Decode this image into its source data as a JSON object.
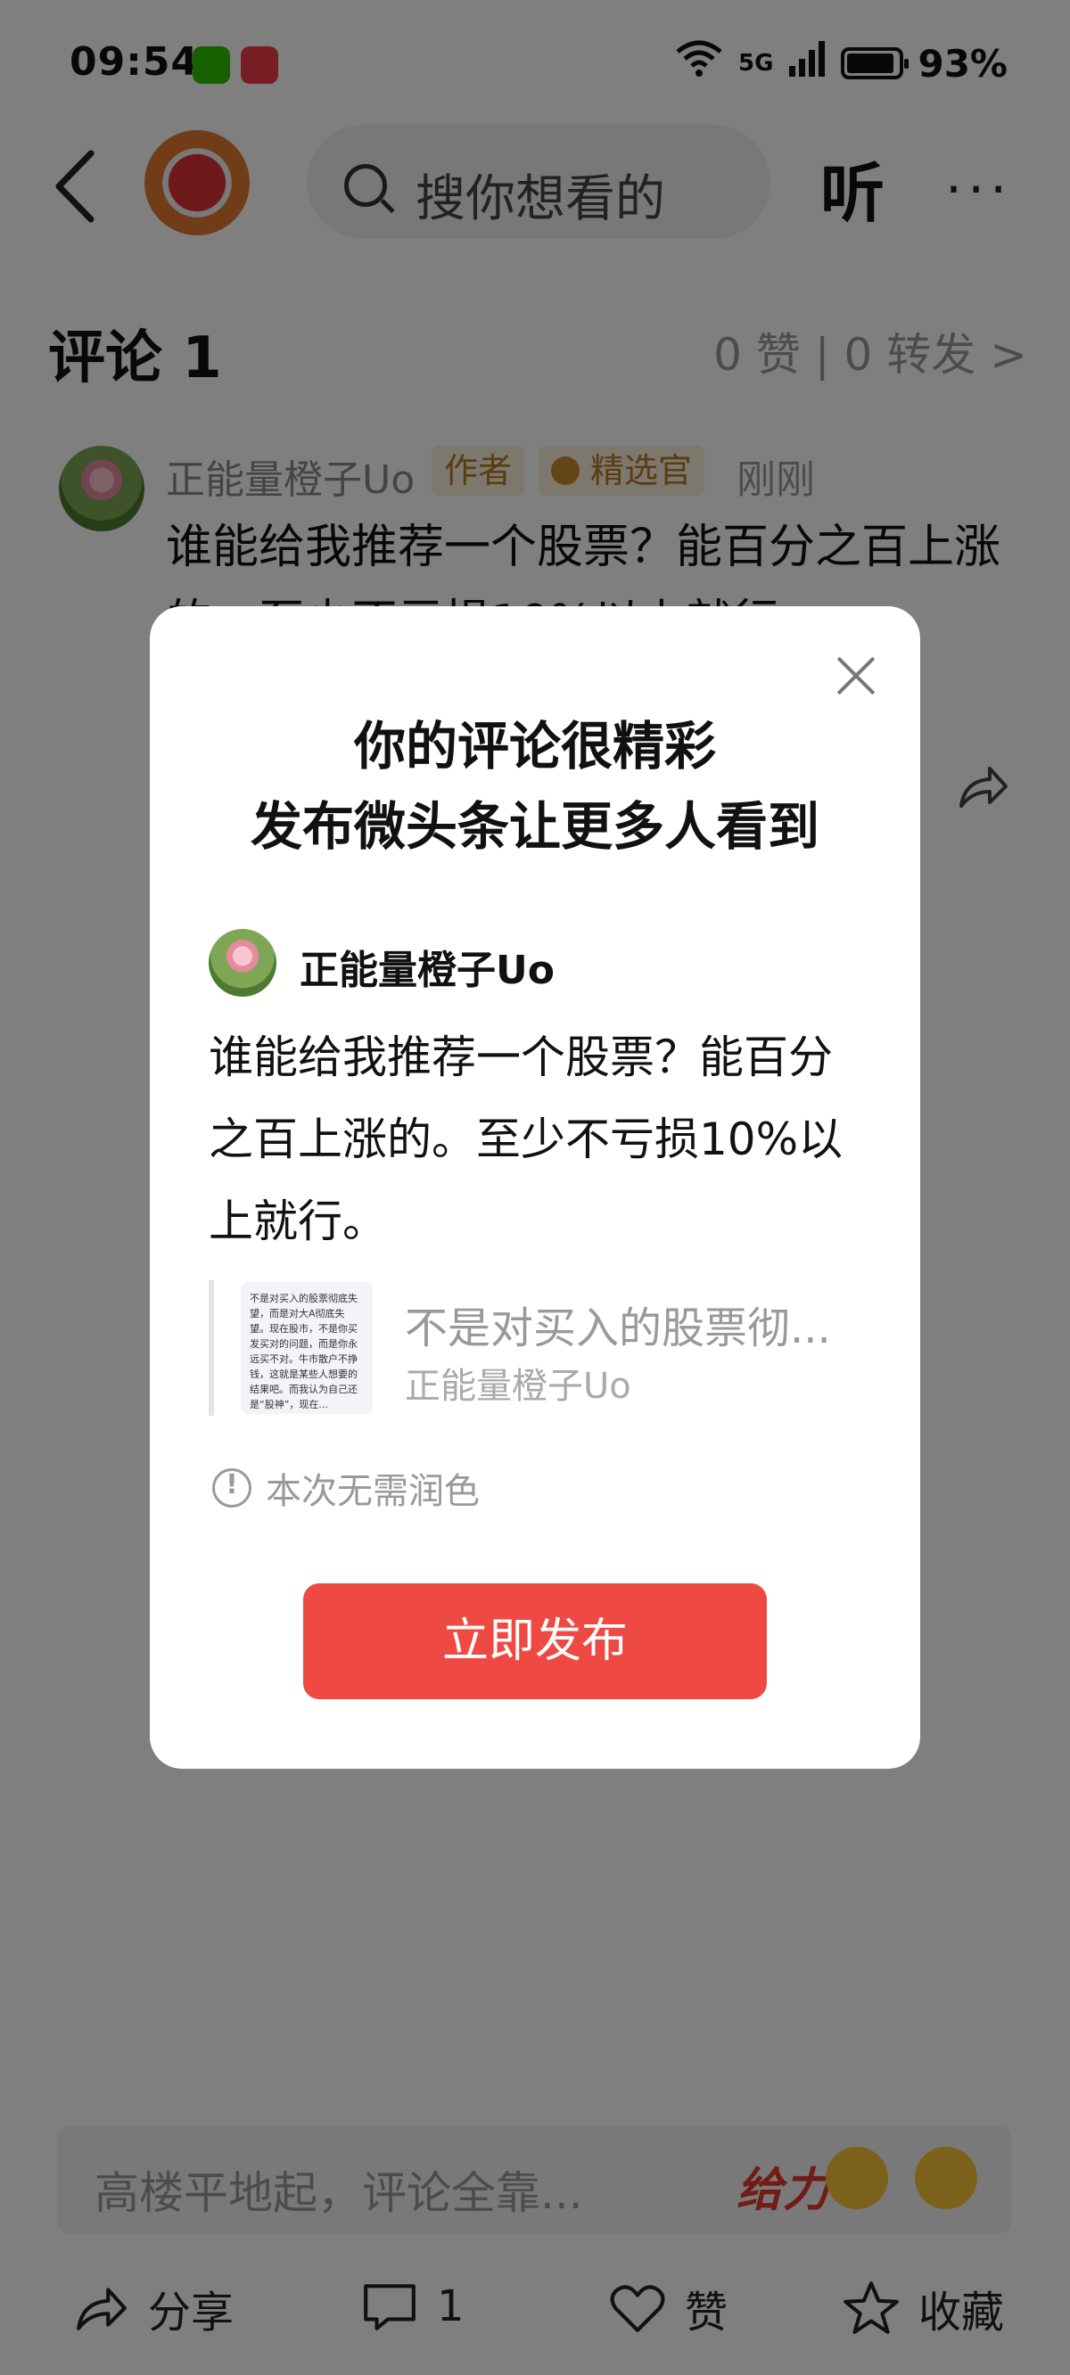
{
  "status_bar": {
    "time": "09:54",
    "network": "5G",
    "battery": "93%"
  },
  "header": {
    "search_placeholder": "搜你想看的",
    "listen_label": "听",
    "more_label": "···"
  },
  "comments": {
    "title": "评论 1",
    "stats": "0 赞 | 0 转发 >",
    "item": {
      "username": "正能量橙子Uo",
      "tag_author": "作者",
      "tag_select": "精选官",
      "time": "刚刚",
      "text": "谁能给我推荐一个股票？能百分之百上涨的。至少不亏损10%以上就行。"
    }
  },
  "modal": {
    "title_line1": "你的评论很精彩",
    "title_line2": "发布微头条让更多人看到",
    "username": "正能量橙子Uo",
    "text": "谁能给我推荐一个股票？能百分之百上涨的。至少不亏损10%以上就行。",
    "quote_thumb_text": "不是对买入的股票彻底失望，而是对大A彻底失望。现在股市，不是你买发买对的问题，而是你永远买不对。牛市散户不挣钱，这就是某些人想要的结果吧。而我认为自己还是“股神”，现在...",
    "quote_title": "不是对买入的股票彻...",
    "quote_author": "正能量橙子Uo",
    "notice": "本次无需润色",
    "publish_button": "立即发布"
  },
  "input_bar": {
    "placeholder": "高楼平地起，评论全靠...",
    "give_label": "给力"
  },
  "bottom_bar": {
    "share": "分享",
    "comment_count": "1",
    "like": "赞",
    "favorite": "收藏"
  }
}
